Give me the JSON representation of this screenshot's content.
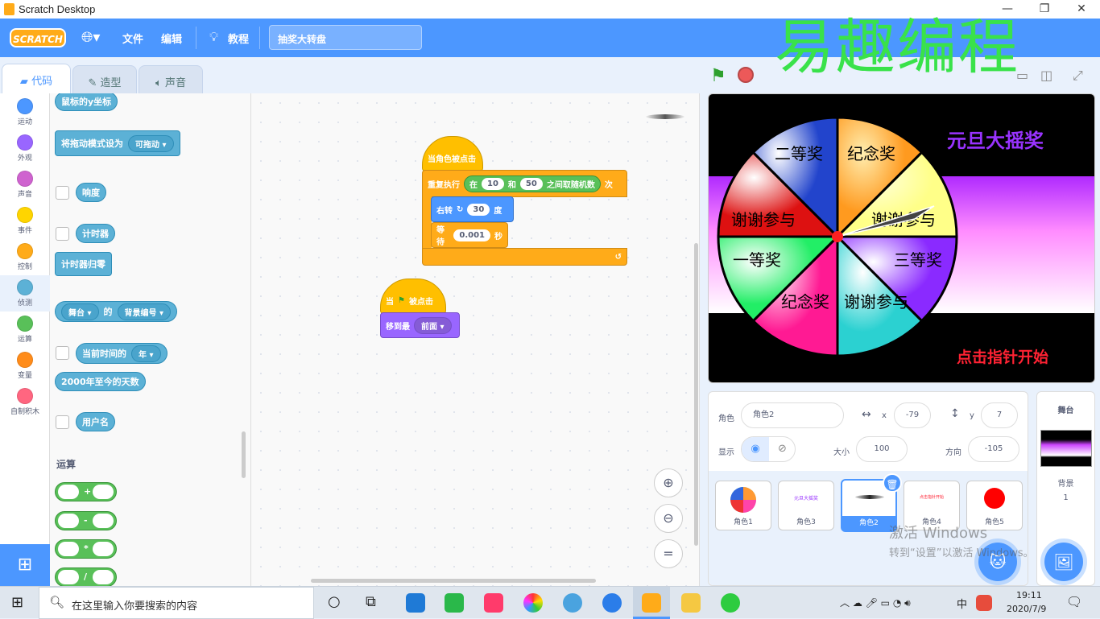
{
  "window": {
    "title": "Scratch Desktop",
    "controls": [
      "—",
      "❐",
      "✕"
    ]
  },
  "menu": {
    "logo": "SCRATCH",
    "file": "文件",
    "edit": "编辑",
    "tutorials": "教程",
    "project_title": "抽奖大转盘"
  },
  "watermark": "易趣编程",
  "tabs": {
    "code": "代码",
    "costumes": "造型",
    "sounds": "声音"
  },
  "categories": [
    {
      "label": "运动",
      "color": "#4c97ff"
    },
    {
      "label": "外观",
      "color": "#9966ff"
    },
    {
      "label": "声音",
      "color": "#cf63cf"
    },
    {
      "label": "事件",
      "color": "#ffd500"
    },
    {
      "label": "控制",
      "color": "#ffab19"
    },
    {
      "label": "侦测",
      "color": "#5cb1d6"
    },
    {
      "label": "运算",
      "color": "#59c059"
    },
    {
      "label": "变量",
      "color": "#ff8c1a"
    },
    {
      "label": "自制积木",
      "color": "#ff6680"
    }
  ],
  "palette": {
    "mouse_y": "鼠标的y坐标",
    "drag_mode": "将拖动模式设为",
    "drag_mode_value": "可拖动",
    "loudness": "响度",
    "timer": "计时器",
    "reset_timer": "计时器归零",
    "stage_dd": "舞台",
    "of": "的",
    "backdrop_num": "背景编号",
    "current_time": "当前时间的",
    "year": "年",
    "days_since": "2000年至今的天数",
    "username": "用户名",
    "operators_heading": "运算",
    "ops": [
      "+",
      "-",
      "*",
      "/"
    ]
  },
  "script1": {
    "hat": "当角色被点击",
    "repeat": "重复执行",
    "in": "在",
    "a": "10",
    "and": "和",
    "b": "50",
    "random": "之间取随机数",
    "times": "次",
    "turn": "右转",
    "deg": "30",
    "deg_unit": "度",
    "wait": "等待",
    "wait_val": "0.001",
    "sec": "秒"
  },
  "script2": {
    "when": "当",
    "clicked": "被点击",
    "goto": "移到最",
    "front": "前面"
  },
  "stage": {
    "title": "元旦大摇奖",
    "hint": "点击指针开始",
    "segments": [
      "二等奖",
      "纪念奖",
      "谢谢参与",
      "谢谢参与",
      "一等奖",
      "三等奖",
      "纪念奖",
      "谢谢参与"
    ]
  },
  "sprite_info": {
    "sprite_label": "角色",
    "name": "角色2",
    "x_label": "x",
    "x": "-79",
    "y_label": "y",
    "y": "7",
    "show_label": "显示",
    "size_label": "大小",
    "size": "100",
    "dir_label": "方向",
    "dir": "-105"
  },
  "sprites": [
    {
      "name": "角色1"
    },
    {
      "name": "角色3",
      "preview": "元旦大摇奖"
    },
    {
      "name": "角色2"
    },
    {
      "name": "角色4",
      "preview": "点击指针开始"
    },
    {
      "name": "角色5"
    }
  ],
  "stage_pane": {
    "label": "舞台",
    "backdrops_label": "背景",
    "backdrops": "1"
  },
  "activation": {
    "line1": "激活 Windows",
    "line2": "转到“设置”以激活 Windows。"
  },
  "taskbar": {
    "search_placeholder": "在这里输入你要搜索的内容",
    "time": "19:11",
    "date": "2020/7/9",
    "ime": "中"
  }
}
